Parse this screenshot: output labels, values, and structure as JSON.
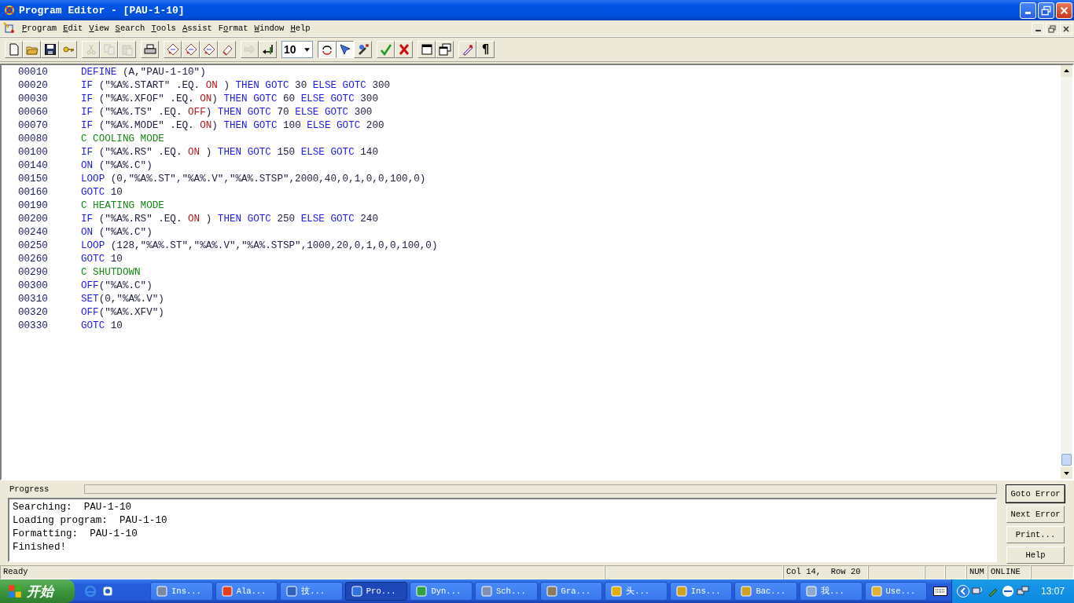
{
  "window": {
    "title": "Program Editor - [PAU-1-10]"
  },
  "menu": [
    "Program",
    "Edit",
    "View",
    "Search",
    "Tools",
    "Assist",
    "Format",
    "Window",
    "Help"
  ],
  "toolbar": [
    {
      "kind": "buttons",
      "buttons": [
        {
          "disabled": false,
          "pressed": false
        },
        {
          "disabled": false,
          "pressed": false
        },
        {
          "disabled": false,
          "pressed": false
        },
        {
          "disabled": false,
          "pressed": false
        }
      ]
    },
    {
      "kind": "buttons",
      "buttons": [
        {
          "disabled": true,
          "pressed": false
        },
        {
          "disabled": true,
          "pressed": false
        },
        {
          "disabled": true,
          "pressed": false
        }
      ]
    },
    {
      "kind": "buttons",
      "buttons": [
        {
          "disabled": false,
          "pressed": false
        }
      ]
    },
    {
      "kind": "buttons",
      "buttons": [
        {
          "disabled": false,
          "pressed": false
        },
        {
          "disabled": false,
          "pressed": false
        },
        {
          "disabled": false,
          "pressed": false
        },
        {
          "disabled": false,
          "pressed": false
        }
      ]
    },
    {
      "kind": "buttons",
      "buttons": [
        {
          "disabled": true,
          "pressed": false
        },
        {
          "disabled": false,
          "pressed": false
        }
      ]
    },
    {
      "kind": "combo",
      "value": "10"
    },
    {
      "kind": "buttons",
      "buttons": [
        {
          "disabled": false,
          "pressed": true
        },
        {
          "disabled": false,
          "pressed": true
        },
        {
          "disabled": false,
          "pressed": false
        }
      ]
    },
    {
      "kind": "buttons",
      "buttons": [
        {
          "disabled": false,
          "pressed": false
        },
        {
          "disabled": false,
          "pressed": false
        }
      ]
    },
    {
      "kind": "buttons",
      "buttons": [
        {
          "disabled": false,
          "pressed": false
        },
        {
          "disabled": false,
          "pressed": false
        }
      ]
    },
    {
      "kind": "buttons",
      "buttons": [
        {
          "disabled": false,
          "pressed": false
        },
        {
          "disabled": false,
          "pressed": false,
          "glyph": "¶"
        }
      ]
    }
  ],
  "code": [
    {
      "number": "00010",
      "tokens": [
        {
          "kind": "kw",
          "text": "DEFINE"
        },
        {
          "kind": "txt",
          "text": " (A,\"PAU-1-10\")"
        }
      ]
    },
    {
      "number": "00020",
      "tokens": [
        {
          "kind": "kw",
          "text": "IF"
        },
        {
          "kind": "txt",
          "text": " (\"%A%.START\" .EQ. "
        },
        {
          "kind": "val",
          "text": "ON"
        },
        {
          "kind": "txt",
          "text": " ) "
        },
        {
          "kind": "kw",
          "text": "THEN GOTC"
        },
        {
          "kind": "txt",
          "text": " 30 "
        },
        {
          "kind": "kw",
          "text": "ELSE GOTC"
        },
        {
          "kind": "txt",
          "text": " 300"
        }
      ]
    },
    {
      "number": "00030",
      "tokens": [
        {
          "kind": "kw",
          "text": "IF"
        },
        {
          "kind": "txt",
          "text": " (\"%A%.XFOF\" .EQ. "
        },
        {
          "kind": "val",
          "text": "ON"
        },
        {
          "kind": "txt",
          "text": ") "
        },
        {
          "kind": "kw",
          "text": "THEN GOTC"
        },
        {
          "kind": "txt",
          "text": " 60 "
        },
        {
          "kind": "kw",
          "text": "ELSE GOTC"
        },
        {
          "kind": "txt",
          "text": " 300"
        }
      ]
    },
    {
      "number": "00060",
      "tokens": [
        {
          "kind": "kw",
          "text": "IF"
        },
        {
          "kind": "txt",
          "text": " (\"%A%.TS\" .EQ. "
        },
        {
          "kind": "val",
          "text": "OFF"
        },
        {
          "kind": "txt",
          "text": ") "
        },
        {
          "kind": "kw",
          "text": "THEN GOTC"
        },
        {
          "kind": "txt",
          "text": " 70 "
        },
        {
          "kind": "kw",
          "text": "ELSE GOTC"
        },
        {
          "kind": "txt",
          "text": " 300"
        }
      ]
    },
    {
      "number": "00070",
      "tokens": [
        {
          "kind": "kw",
          "text": "IF"
        },
        {
          "kind": "txt",
          "text": " (\"%A%.MODE\" .EQ. "
        },
        {
          "kind": "val",
          "text": "ON"
        },
        {
          "kind": "txt",
          "text": ") "
        },
        {
          "kind": "kw",
          "text": "THEN GOTC"
        },
        {
          "kind": "txt",
          "text": " 100 "
        },
        {
          "kind": "kw",
          "text": "ELSE GOTC"
        },
        {
          "kind": "txt",
          "text": " 200"
        }
      ]
    },
    {
      "number": "00080",
      "tokens": [
        {
          "kind": "cmt",
          "text": "C COOLING MODE"
        }
      ]
    },
    {
      "number": "00100",
      "tokens": [
        {
          "kind": "kw",
          "text": "IF"
        },
        {
          "kind": "txt",
          "text": " (\"%A%.RS\" .EQ. "
        },
        {
          "kind": "val",
          "text": "ON"
        },
        {
          "kind": "txt",
          "text": " ) "
        },
        {
          "kind": "kw",
          "text": "THEN GOTC"
        },
        {
          "kind": "txt",
          "text": " 150 "
        },
        {
          "kind": "kw",
          "text": "ELSE GOTC"
        },
        {
          "kind": "txt",
          "text": " 140"
        }
      ]
    },
    {
      "number": "00140",
      "tokens": [
        {
          "kind": "kw",
          "text": "ON"
        },
        {
          "kind": "txt",
          "text": " (\"%A%.C\")"
        }
      ]
    },
    {
      "number": "00150",
      "tokens": [
        {
          "kind": "kw",
          "text": "LOOP"
        },
        {
          "kind": "txt",
          "text": " (0,\"%A%.ST\",\"%A%.V\",\"%A%.STSP\",2000,40,0,1,0,0,100,0)"
        }
      ]
    },
    {
      "number": "00160",
      "tokens": [
        {
          "kind": "kw",
          "text": "GOTC"
        },
        {
          "kind": "txt",
          "text": " 10"
        }
      ]
    },
    {
      "number": "00190",
      "tokens": [
        {
          "kind": "cmt",
          "text": "C HEATING MODE"
        }
      ]
    },
    {
      "number": "00200",
      "tokens": [
        {
          "kind": "kw",
          "text": "IF"
        },
        {
          "kind": "txt",
          "text": " (\"%A%.RS\" .EQ. "
        },
        {
          "kind": "val",
          "text": "ON"
        },
        {
          "kind": "txt",
          "text": " ) "
        },
        {
          "kind": "kw",
          "text": "THEN GOTC"
        },
        {
          "kind": "txt",
          "text": " 250 "
        },
        {
          "kind": "kw",
          "text": "ELSE GOTC"
        },
        {
          "kind": "txt",
          "text": " 240"
        }
      ]
    },
    {
      "number": "00240",
      "tokens": [
        {
          "kind": "kw",
          "text": "ON"
        },
        {
          "kind": "txt",
          "text": " (\"%A%.C\")"
        }
      ]
    },
    {
      "number": "00250",
      "tokens": [
        {
          "kind": "kw",
          "text": "LOOP"
        },
        {
          "kind": "txt",
          "text": " (128,\"%A%.ST\",\"%A%.V\",\"%A%.STSP\",1000,20,0,1,0,0,100,0)"
        }
      ]
    },
    {
      "number": "00260",
      "tokens": [
        {
          "kind": "kw",
          "text": "GOTC"
        },
        {
          "kind": "txt",
          "text": " 10"
        }
      ]
    },
    {
      "number": "00290",
      "tokens": [
        {
          "kind": "cmt",
          "text": "C SHUTDOWN"
        }
      ]
    },
    {
      "number": "00300",
      "tokens": [
        {
          "kind": "kw",
          "text": "OFF"
        },
        {
          "kind": "txt",
          "text": "(\"%A%.C\")"
        }
      ]
    },
    {
      "number": "00310",
      "tokens": [
        {
          "kind": "kw",
          "text": "SET"
        },
        {
          "kind": "txt",
          "text": "(0,\"%A%.V\")"
        }
      ]
    },
    {
      "number": "00320",
      "tokens": [
        {
          "kind": "kw",
          "text": "OFF"
        },
        {
          "kind": "txt",
          "text": "(\"%A%.XFV\")"
        }
      ]
    },
    {
      "number": "00330",
      "tokens": [
        {
          "kind": "kw",
          "text": "GOTC"
        },
        {
          "kind": "txt",
          "text": " 10"
        }
      ]
    }
  ],
  "progress": {
    "label": "Progress",
    "level": 0,
    "messages": [
      "Searching:  PAU-1-10",
      "Loading program:  PAU-1-10",
      "Formatting:  PAU-1-10",
      "Finished!"
    ],
    "buttons": [
      {
        "label": "Goto Error",
        "default": true
      },
      {
        "label": "Next Error",
        "default": false
      },
      {
        "label": "Print...",
        "default": false
      },
      {
        "label": "Help",
        "default": false
      }
    ]
  },
  "status_bar": {
    "message": "Ready",
    "position": "Col 14,  Row 20",
    "num": "NUM",
    "mode": "ONLINE"
  },
  "taskbar": {
    "start": "开始",
    "tasks": [
      {
        "label": "Ins...",
        "selected": false
      },
      {
        "label": "Ala...",
        "selected": false
      },
      {
        "label": "技...",
        "selected": false
      },
      {
        "label": "Pro...",
        "selected": true
      },
      {
        "label": "Dyn...",
        "selected": false
      },
      {
        "label": "Sch...",
        "selected": false
      },
      {
        "label": "Gra...",
        "selected": false
      },
      {
        "label": "头...",
        "selected": false
      },
      {
        "label": "Ins...",
        "selected": false
      },
      {
        "label": "Bac...",
        "selected": false
      },
      {
        "label": "我...",
        "selected": false
      },
      {
        "label": "Use...",
        "selected": false
      }
    ],
    "clock": "13:07"
  }
}
